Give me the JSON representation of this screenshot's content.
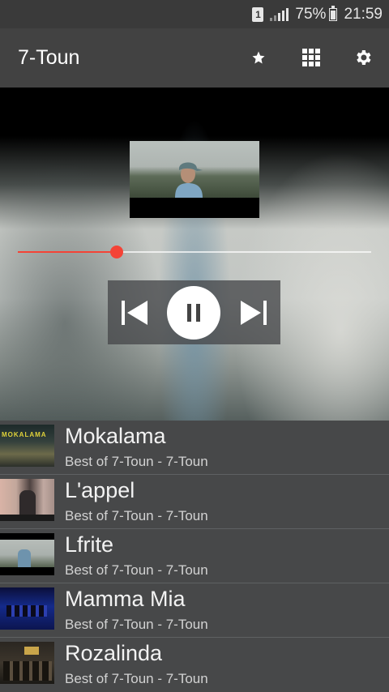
{
  "status_bar": {
    "sim_label": "1",
    "battery": "75%",
    "time": "21:59"
  },
  "app_bar": {
    "title": "7-Toun",
    "icons": [
      "star-icon",
      "grid-icon",
      "gear-icon"
    ]
  },
  "player": {
    "progress": 0.28,
    "state": "playing",
    "accent_color": "#f44336"
  },
  "tracks": [
    {
      "title": "Mokalama",
      "subtitle": "Best of 7-Toun - 7-Toun",
      "thumb_text": "MOKALAMA"
    },
    {
      "title": "L'appel",
      "subtitle": "Best of 7-Toun - 7-Toun"
    },
    {
      "title": "Lfrite",
      "subtitle": "Best of 7-Toun - 7-Toun"
    },
    {
      "title": "Mamma Mia",
      "subtitle": "Best of 7-Toun - 7-Toun"
    },
    {
      "title": "Rozalinda",
      "subtitle": "Best of 7-Toun - 7-Toun"
    }
  ]
}
